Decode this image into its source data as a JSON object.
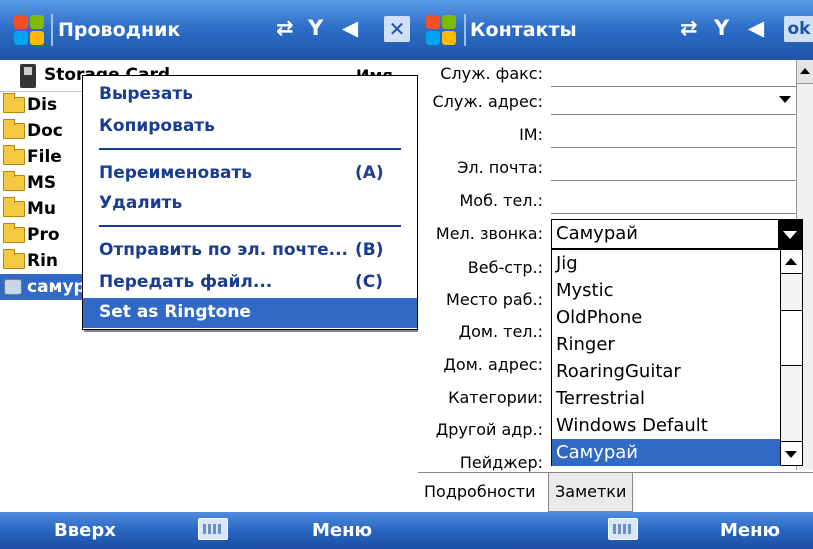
{
  "left_screen": {
    "title": "Проводник",
    "path": "Storage Card",
    "sort": "Имя",
    "files": [
      "Dis",
      "Doc",
      "File",
      "MS",
      "Mu",
      "Pro",
      "Rin"
    ],
    "selected_file": "самурай",
    "context_menu": {
      "cut": "Вырезать",
      "copy": "Копировать",
      "rename": "Переименовать",
      "rename_key": "(A)",
      "delete": "Удалить",
      "send_email": "Отправить по эл. почте...",
      "send_email_key": "(B)",
      "beam": "Передать файл...",
      "beam_key": "(C)",
      "set_ringtone": "Set as Ringtone"
    },
    "softkey_left": "Вверх",
    "softkey_right": "Меню"
  },
  "right_screen": {
    "title": "Контакты",
    "ok": "ok",
    "fields": {
      "work_fax": "Служ. факс:",
      "work_address": "Служ. адрес:",
      "im": "IM:",
      "email": "Эл. почта:",
      "mobile": "Моб. тел.:",
      "ringtone": "Мел. звонка:",
      "web": "Веб-стр.:",
      "office": "Место раб.:",
      "home_phone": "Дом. тел.:",
      "home_address": "Дом. адрес:",
      "categories": "Категории:",
      "other_address": "Другой адр.:",
      "pager": "Пейджер:"
    },
    "ringtone_value": "Самурай",
    "ringtone_options": [
      "Jig",
      "Mystic",
      "OldPhone",
      "Ringer",
      "RoaringGuitar",
      "Terrestrial",
      "Windows Default",
      "Самурай"
    ],
    "tabs": [
      "Подробности",
      "Заметки"
    ],
    "softkey_right": "Меню"
  }
}
